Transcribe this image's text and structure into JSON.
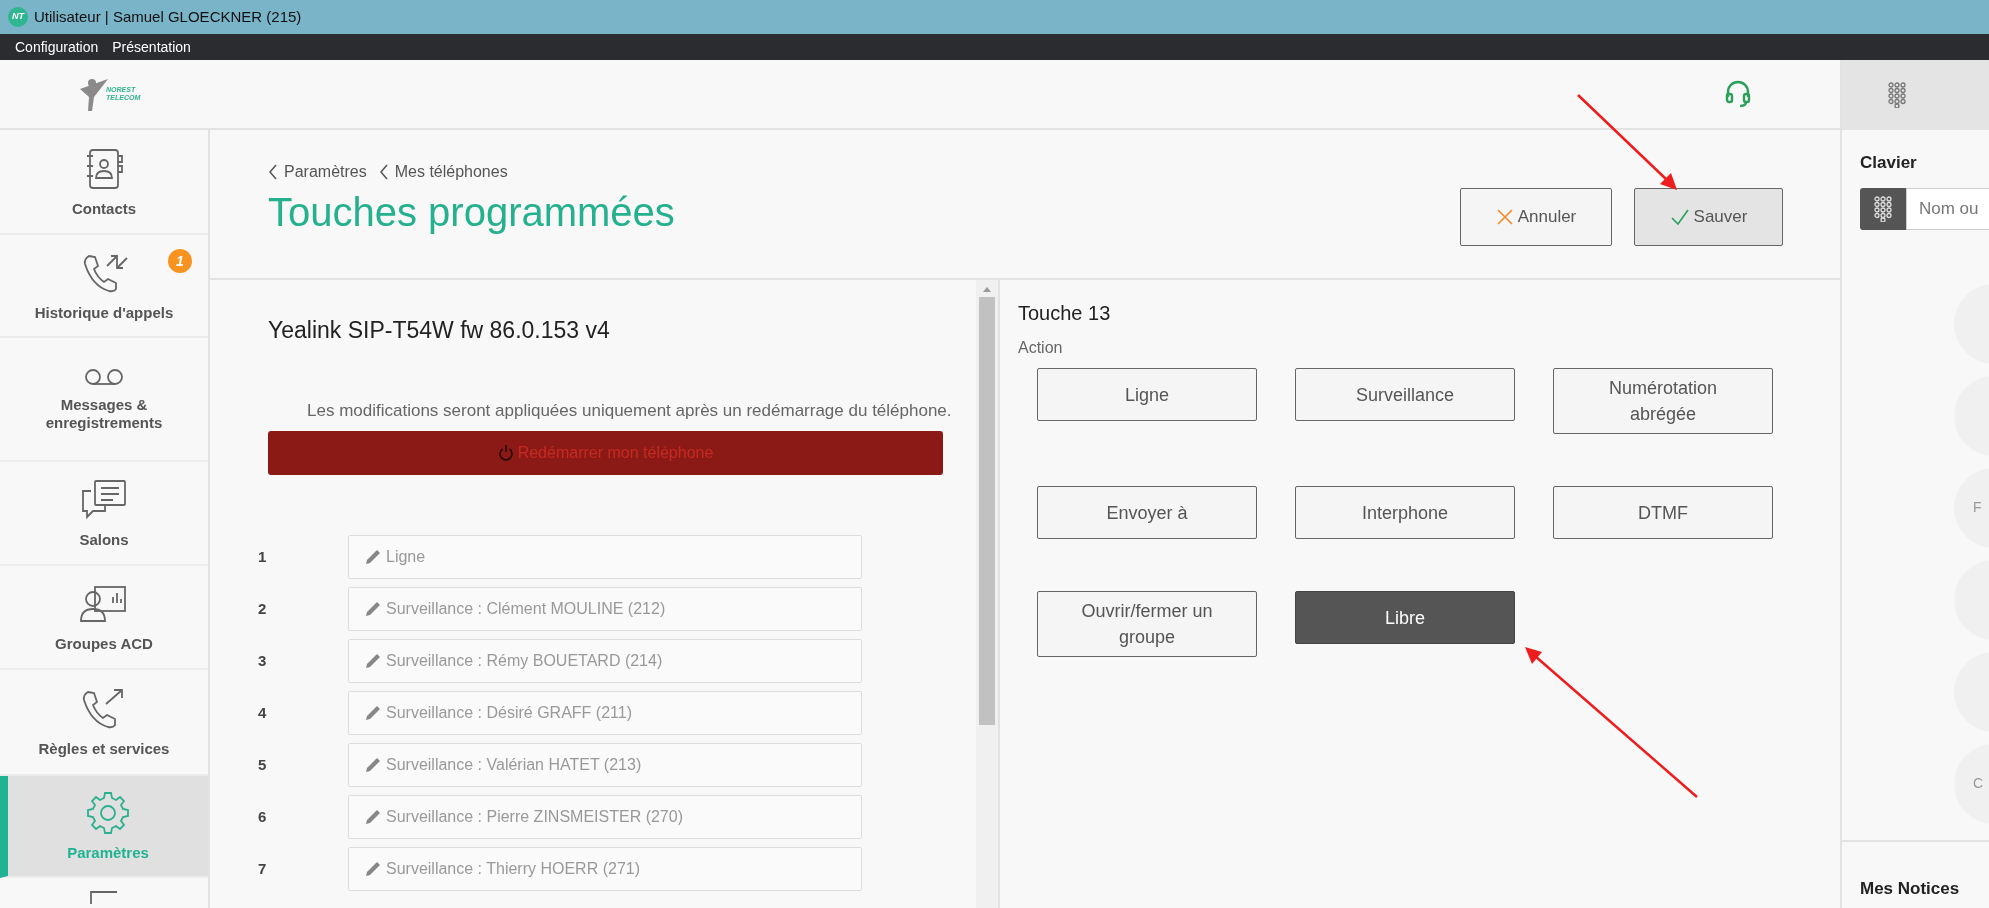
{
  "window": {
    "app_icon": "NT",
    "title": "Utilisateur | Samuel GLOECKNER (215)"
  },
  "menu": [
    "Configuration",
    "Présentation"
  ],
  "logo": {
    "lines": [
      "NOREST",
      "TELECOM"
    ]
  },
  "sidebar": {
    "items": [
      {
        "label": "Contacts",
        "selected": false
      },
      {
        "label": "Historique d'appels",
        "selected": false,
        "badge": "1"
      },
      {
        "label": "Messages & enregistrements",
        "selected": false
      },
      {
        "label": "Salons",
        "selected": false
      },
      {
        "label": "Groupes ACD",
        "selected": false
      },
      {
        "label": "Règles et services",
        "selected": false
      },
      {
        "label": "Paramètres",
        "selected": true
      }
    ]
  },
  "breadcrumb": [
    "Paramètres",
    "Mes téléphones"
  ],
  "page_title": "Touches programmées",
  "header_buttons": [
    {
      "kind": "cancel",
      "label": "Annuler"
    },
    {
      "kind": "save",
      "label": "Sauver"
    }
  ],
  "device": {
    "title": "Yealink SIP-T54W fw 86.0.153 v4",
    "notice": "Les modifications seront appliquées uniquement après un redémarrage du téléphone.",
    "restart_button": "Redémarrer mon téléphone"
  },
  "keys": [
    {
      "number": "1",
      "value": "Ligne"
    },
    {
      "number": "2",
      "value": "Surveillance : Clément MOULINE (212)"
    },
    {
      "number": "3",
      "value": "Surveillance : Rémy BOUETARD (214)"
    },
    {
      "number": "4",
      "value": "Surveillance : Désiré GRAFF (211)"
    },
    {
      "number": "5",
      "value": "Surveillance : Valérian HATET (213)"
    },
    {
      "number": "6",
      "value": "Surveillance : Pierre ZINSMEISTER (270)"
    },
    {
      "number": "7",
      "value": "Surveillance : Thierry HOERR (271)"
    }
  ],
  "key_editor": {
    "title": "Touche 13",
    "action_label": "Action",
    "actions": [
      {
        "label": "Ligne",
        "selected": false
      },
      {
        "label": "Surveillance",
        "selected": false
      },
      {
        "label": "Numérotation abrégée",
        "selected": false
      },
      {
        "label": "Envoyer à",
        "selected": false
      },
      {
        "label": "Interphone",
        "selected": false
      },
      {
        "label": "DTMF",
        "selected": false
      },
      {
        "label": "Ouvrir/fermer un groupe",
        "selected": false
      },
      {
        "label": "Libre",
        "selected": true
      }
    ]
  },
  "keypad_panel": {
    "title": "Clavier",
    "search_placeholder": "Nom ou",
    "keys": [
      {
        "kind": "blank"
      },
      {
        "kind": "blank"
      },
      {
        "kind": "lettered",
        "label": "F"
      },
      {
        "kind": "blank"
      },
      {
        "kind": "blank"
      },
      {
        "kind": "lettered",
        "label": "C"
      }
    ],
    "notices_title": "Mes Notices"
  }
}
